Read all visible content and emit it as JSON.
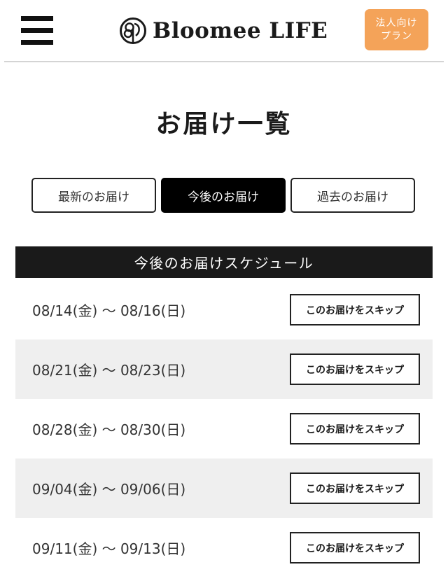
{
  "header": {
    "menu_icon": "hamburger-menu-icon",
    "logo_icon": "bloomee-logo-icon",
    "logo_text": "Bloomee LIFE",
    "corp_button": {
      "line1": "法人向け",
      "line2": "プラン"
    }
  },
  "page": {
    "title": "お届け一覧"
  },
  "tabs": [
    {
      "label": "最新のお届け",
      "active": false
    },
    {
      "label": "今後のお届け",
      "active": true
    },
    {
      "label": "過去のお届け",
      "active": false
    }
  ],
  "schedule": {
    "title": "今後のお届けスケジュール",
    "rows": [
      {
        "date": "08/14(金) 〜 08/16(日)",
        "action": "このお届けをスキップ"
      },
      {
        "date": "08/21(金) 〜 08/23(日)",
        "action": "このお届けをスキップ"
      },
      {
        "date": "08/28(金) 〜 08/30(日)",
        "action": "このお届けをスキップ"
      },
      {
        "date": "09/04(金) 〜 09/06(日)",
        "action": "このお届けをスキップ"
      },
      {
        "date": "09/11(金) 〜 09/13(日)",
        "action": "このお届けをスキップ"
      }
    ]
  },
  "colors": {
    "corp_button": "#f4a359",
    "active_tab": "#000000",
    "section_header": "#1a1a1a",
    "alt_row": "#efefef"
  }
}
